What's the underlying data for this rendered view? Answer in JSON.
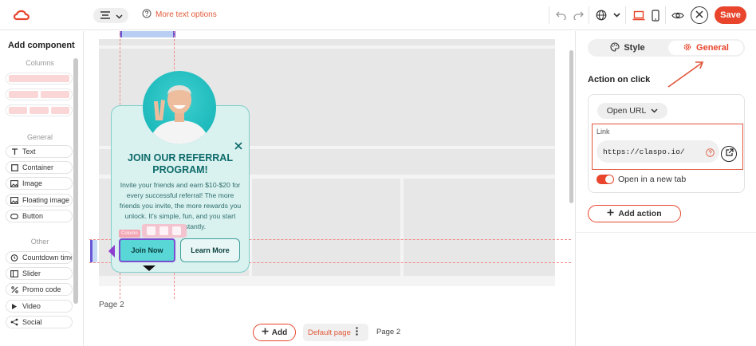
{
  "toolbar": {
    "more_text_options": "More text options",
    "save_label": "Save"
  },
  "left_panel": {
    "title": "Add component",
    "sections": {
      "columns": "Columns",
      "general": "General",
      "other": "Other"
    },
    "general_items": [
      {
        "label": "Text",
        "icon": "text-icon"
      },
      {
        "label": "Container",
        "icon": "container-icon"
      },
      {
        "label": "Image",
        "icon": "image-icon"
      },
      {
        "label": "Floating image",
        "icon": "floating-image-icon"
      },
      {
        "label": "Button",
        "icon": "button-icon"
      }
    ],
    "other_items": [
      {
        "label": "Countdown timer",
        "icon": "countdown-icon"
      },
      {
        "label": "Slider",
        "icon": "slider-icon"
      },
      {
        "label": "Promo code",
        "icon": "percent-icon"
      },
      {
        "label": "Video",
        "icon": "play-icon"
      },
      {
        "label": "Social",
        "icon": "share-icon"
      }
    ]
  },
  "popup": {
    "title_line1": "JOIN OUR REFERRAL",
    "title_line2": "PROGRAM!",
    "body": "Invite your friends and earn $10-$20 for every successful referral! The more friends you invite, the more rewards you unlock. It's simple, fun, and you start earning instantly.",
    "primary_button": "Join Now",
    "secondary_button": "Learn More",
    "column_tag": "Column"
  },
  "canvas": {
    "page_label": "Page 2"
  },
  "bottom_bar": {
    "add_label": "Add",
    "default_page_label": "Default page",
    "page2_label": "Page 2"
  },
  "right_panel": {
    "tab_style": "Style",
    "tab_general": "General",
    "action_on_click": "Action on click",
    "action_type": "Open URL",
    "link_label": "Link",
    "link_value": "https://claspo.io/",
    "open_new_tab_label": "Open in a new tab",
    "open_new_tab_enabled": true,
    "add_action_label": "Add action"
  },
  "colors": {
    "accent": "#e8452c",
    "popup_bg": "#d9f1ef",
    "popup_title": "#0d6a6a",
    "button_teal": "#59d6d6"
  }
}
